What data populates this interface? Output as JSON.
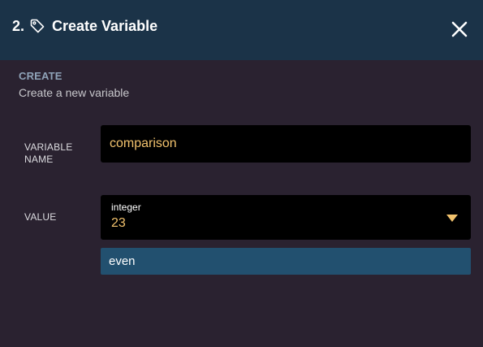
{
  "header": {
    "step": "2.",
    "title": "Create Variable",
    "icon": "tag-icon",
    "close_icon": "close-icon",
    "background": "#1b3348"
  },
  "section": {
    "heading": "CREATE",
    "subheading": "Create a new variable"
  },
  "form": {
    "name_label": "VARIABLE NAME",
    "name_value": "comparison",
    "value_label": "VALUE",
    "value_type": "integer",
    "value_value": "23",
    "dropdown_icon": "caret-down-icon",
    "option": "even"
  },
  "colors": {
    "background": "#2a2230",
    "input_background": "#000000",
    "value_text": "#f2c26d",
    "option_highlight": "#22506f"
  }
}
